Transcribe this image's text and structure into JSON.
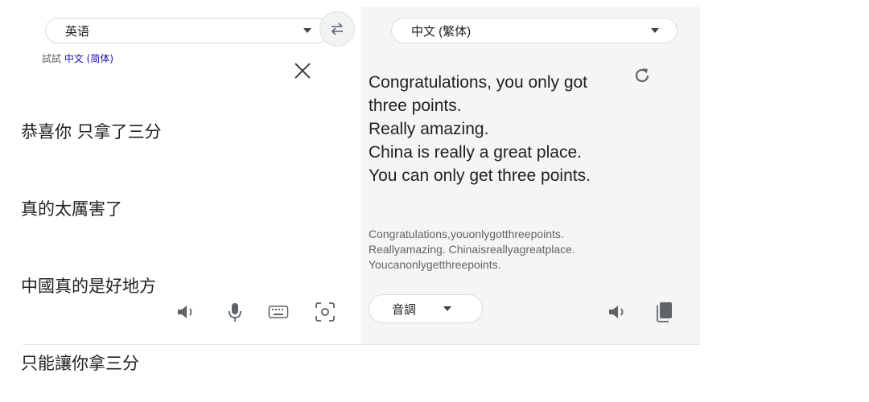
{
  "source": {
    "language": "英语",
    "try_prefix": "試試",
    "try_link": "中文 (简体)",
    "lines": [
      "恭喜你 只拿了三分",
      "真的太厲害了",
      "中國真的是好地方",
      "只能讓你拿三分"
    ]
  },
  "target": {
    "language": "中文 (繁体)",
    "lines": [
      "Congratulations, you only got",
      "three points.",
      "Really amazing.",
      "China is really a great place.",
      "You can only get three points."
    ],
    "romanization": [
      "Congratulations,youonlygotthreepoints.",
      "Reallyamazing. Chinaisreallyagreatplace.",
      "Youcanonlygetthreepoints."
    ],
    "tone_label": "音調"
  },
  "colors": {
    "accent_link": "#1a0dab",
    "right_pane": "#f5f5f5",
    "icon": "#5f6368"
  },
  "icons": {
    "swap": "swap-arrows-icon",
    "clear": "close-icon",
    "refresh": "refresh-icon",
    "speaker": "speaker-icon",
    "mic": "microphone-icon",
    "keyboard": "keyboard-icon",
    "camera": "camera-scan-icon",
    "copy": "copy-icon"
  }
}
